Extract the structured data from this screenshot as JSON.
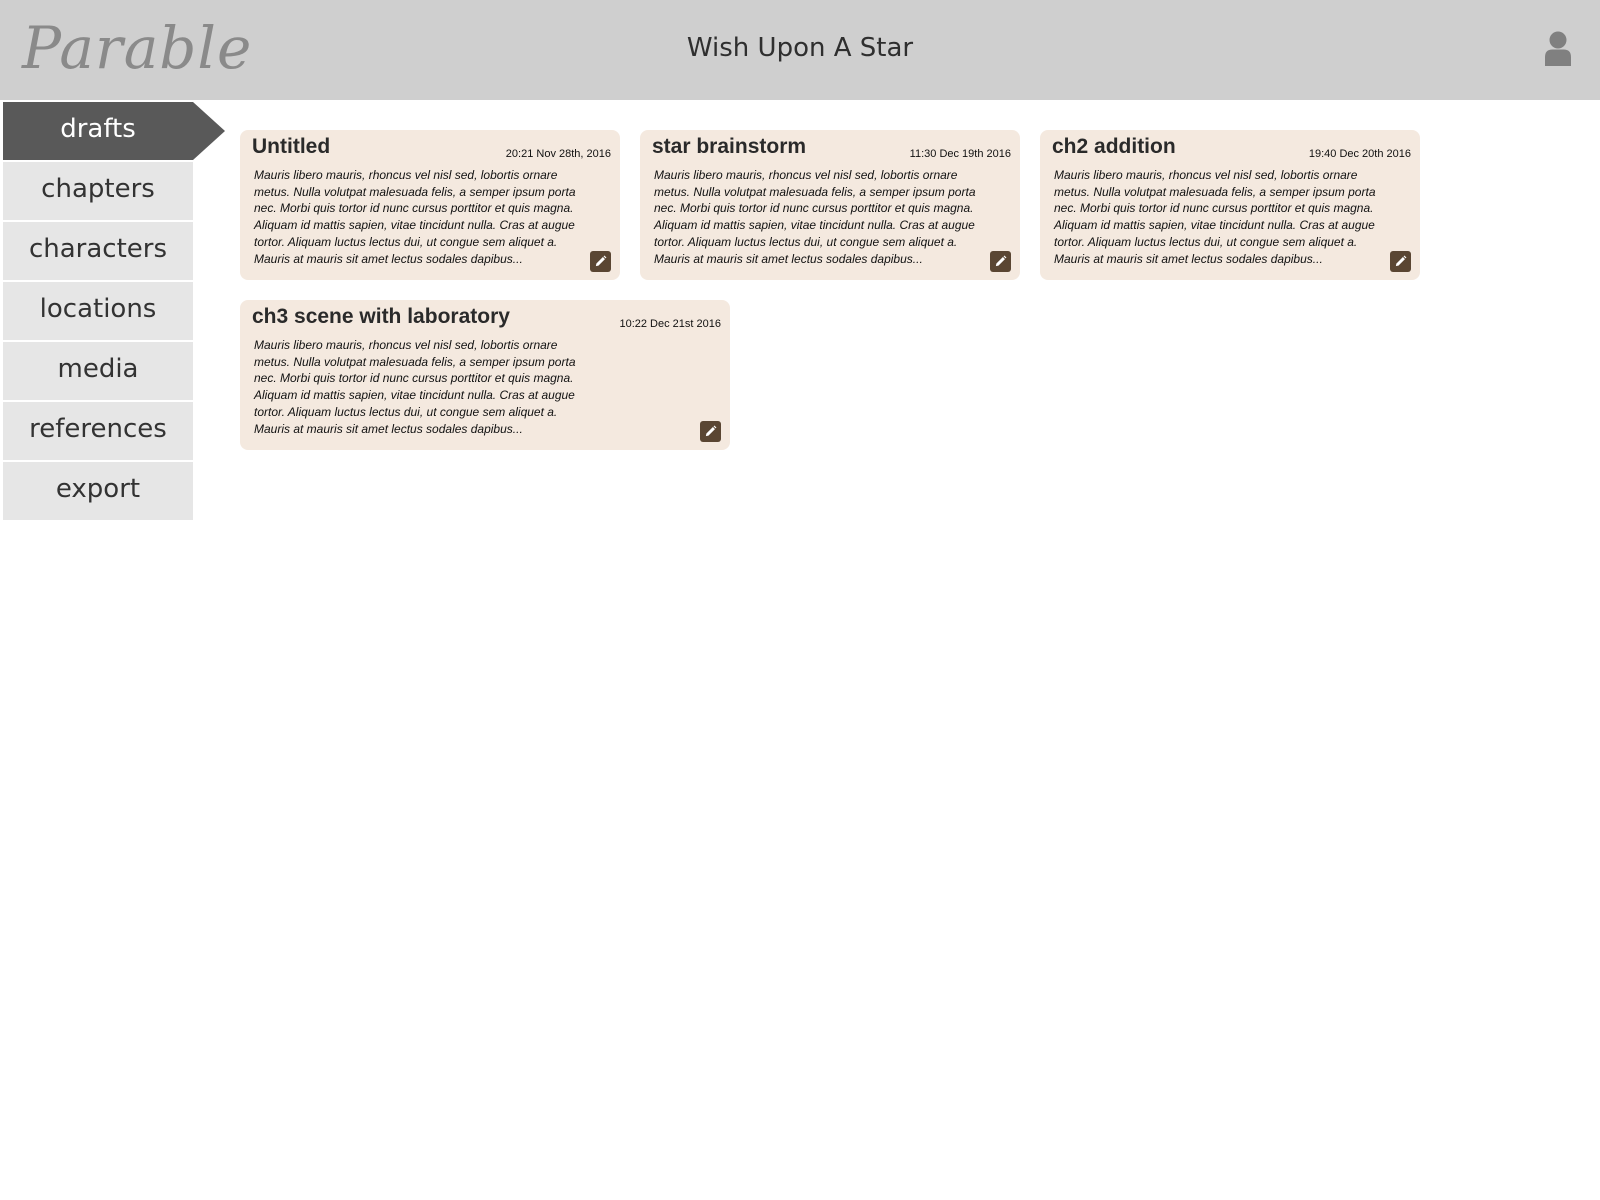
{
  "header": {
    "logo_text": "Parable",
    "title": "Wish Upon A Star",
    "user_icon": "user-icon"
  },
  "sidebar": {
    "items": [
      {
        "label": "drafts",
        "active": true
      },
      {
        "label": "chapters",
        "active": false
      },
      {
        "label": "characters",
        "active": false
      },
      {
        "label": "locations",
        "active": false
      },
      {
        "label": "media",
        "active": false
      },
      {
        "label": "references",
        "active": false
      },
      {
        "label": "export",
        "active": false
      }
    ]
  },
  "drafts": [
    {
      "title": "Untitled",
      "date": "20:21 Nov 28th, 2016",
      "excerpt": "Mauris libero mauris, rhoncus vel nisl sed, lobortis ornare metus. Nulla volutpat malesuada felis, a semper ipsum porta nec. Morbi quis tortor id nunc cursus porttitor et quis magna. Aliquam id mattis sapien, vitae tincidunt nulla. Cras at augue tortor. Aliquam luctus lectus dui, ut congue sem aliquet a. Mauris at mauris sit amet lectus sodales dapibus..."
    },
    {
      "title": "star brainstorm",
      "date": "11:30 Dec 19th 2016",
      "excerpt": "Mauris libero mauris, rhoncus vel nisl sed, lobortis ornare metus. Nulla volutpat malesuada felis, a semper ipsum porta nec. Morbi quis tortor id nunc cursus porttitor et quis magna. Aliquam id mattis sapien, vitae tincidunt nulla. Cras at augue tortor. Aliquam luctus lectus dui, ut congue sem aliquet a. Mauris at mauris sit amet lectus sodales dapibus..."
    },
    {
      "title": "ch2 addition",
      "date": "19:40 Dec 20th 2016",
      "excerpt": "Mauris libero mauris, rhoncus vel nisl sed, lobortis ornare metus. Nulla volutpat malesuada felis, a semper ipsum porta nec. Morbi quis tortor id nunc cursus porttitor et quis magna. Aliquam id mattis sapien, vitae tincidunt nulla. Cras at augue tortor. Aliquam luctus lectus dui, ut congue sem aliquet a. Mauris at mauris sit amet lectus sodales dapibus..."
    },
    {
      "title": "ch3 scene with laboratory",
      "date": "10:22 Dec 21st 2016",
      "excerpt": "Mauris libero mauris, rhoncus vel nisl sed, lobortis ornare metus. Nulla volutpat malesuada felis, a semper ipsum porta nec. Morbi quis tortor id nunc cursus porttitor et quis magna. Aliquam id mattis sapien, vitae tincidunt nulla. Cras at augue tortor. Aliquam luctus lectus dui, ut congue sem aliquet a. Mauris at mauris sit amet lectus sodales dapibus..."
    }
  ],
  "edit_icon": "pencil-icon",
  "colors": {
    "header_bg": "#cfcfcf",
    "nav_active": "#595959",
    "nav_inactive": "#e6e6e6",
    "card_bg": "#f4e9df",
    "edit_button": "#5a4633"
  }
}
